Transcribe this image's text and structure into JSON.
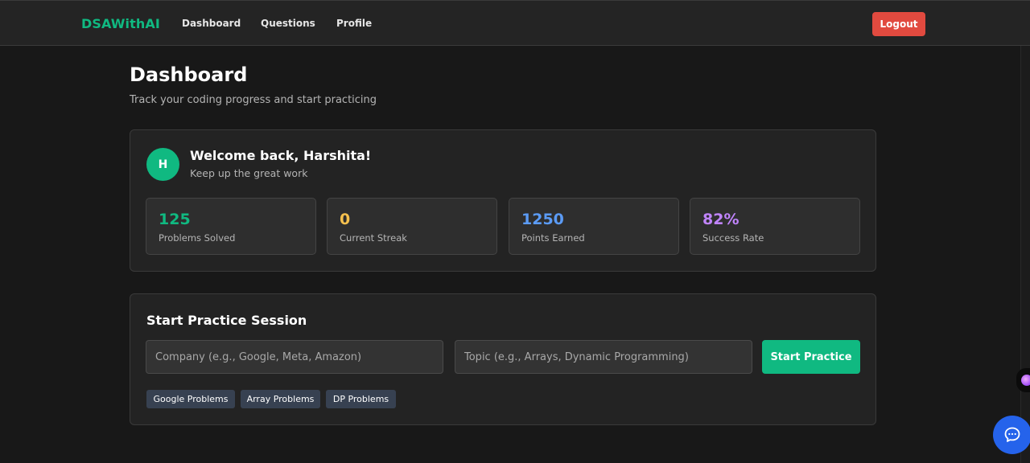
{
  "navbar": {
    "brand": "DSAWithAI",
    "links": [
      "Dashboard",
      "Questions",
      "Profile"
    ],
    "logout_label": "Logout"
  },
  "page": {
    "title": "Dashboard",
    "subtitle": "Track your coding progress and start practicing"
  },
  "welcome": {
    "avatar_initial": "H",
    "title": "Welcome back, Harshita!",
    "subtitle": "Keep up the great work"
  },
  "stats": [
    {
      "value": "125",
      "label": "Problems Solved",
      "color": "#10b981"
    },
    {
      "value": "0",
      "label": "Current Streak",
      "color": "#f5c04e"
    },
    {
      "value": "1250",
      "label": "Points Earned",
      "color": "#5b9bf5"
    },
    {
      "value": "82%",
      "label": "Success Rate",
      "color": "#c084fc"
    }
  ],
  "practice": {
    "title": "Start Practice Session",
    "company_placeholder": "Company (e.g., Google, Meta, Amazon)",
    "topic_placeholder": "Topic (e.g., Arrays, Dynamic Programming)",
    "start_label": "Start Practice",
    "chips": [
      "Google Problems",
      "Array Problems",
      "DP Problems"
    ]
  },
  "colors": {
    "accent": "#10b981",
    "logout": "#e14a3f",
    "chat": "#2563eb",
    "background": "#181818",
    "card": "#232323"
  },
  "icons": {
    "chat": "chat-bubble-icon",
    "side_widget": "assistant-orb-icon"
  }
}
